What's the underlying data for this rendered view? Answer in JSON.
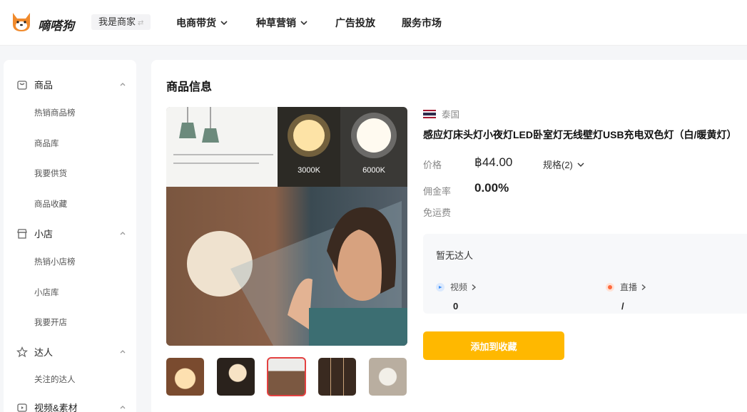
{
  "header": {
    "logo_icon": "shiba-dog-logo",
    "logo_name": "嘀嗒狗",
    "merchant_label": "我是商家",
    "merchant_swap_icon": "swap-icon",
    "nav": [
      {
        "label": "电商带货",
        "has_dropdown": true
      },
      {
        "label": "种草营销",
        "has_dropdown": true
      },
      {
        "label": "广告投放",
        "has_dropdown": false
      },
      {
        "label": "服务市场",
        "has_dropdown": false
      }
    ]
  },
  "sidebar": {
    "groups": [
      {
        "label": "商品",
        "icon": "bag-icon",
        "items": [
          "热销商品榜",
          "商品库",
          "我要供货",
          "商品收藏"
        ]
      },
      {
        "label": "小店",
        "icon": "store-icon",
        "items": [
          "热销小店榜",
          "小店库",
          "我要开店"
        ]
      },
      {
        "label": "达人",
        "icon": "star-icon",
        "items": [
          "关注的达人"
        ]
      },
      {
        "label": "视频&素材",
        "icon": "video-icon",
        "items": []
      }
    ]
  },
  "product": {
    "section_title": "商品信息",
    "country": "泰国",
    "title": "感应灯床头灯小夜灯LED卧室灯无线壁灯USB充电双色灯（白/暖黄灯）",
    "price_label": "价格",
    "price": "฿44.00",
    "spec_label": "规格(2)",
    "commission_label": "佣金率",
    "commission": "0.00%",
    "shipping_label": "免运费",
    "image_texts": {
      "warm_temp": "3000K",
      "cool_temp": "6000K"
    },
    "thumbnail_count": 5,
    "active_thumbnail": 3
  },
  "talent": {
    "title": "暂无达人",
    "video_label": "视频",
    "video_value": "0",
    "live_label": "直播",
    "live_value": "/"
  },
  "actions": {
    "add_favorite": "添加到收藏"
  },
  "colors": {
    "accent": "#ffb800",
    "active_thumb_border": "#e34141",
    "video_dot": "#3d8ef7",
    "live_dot": "#ff6a3d"
  }
}
